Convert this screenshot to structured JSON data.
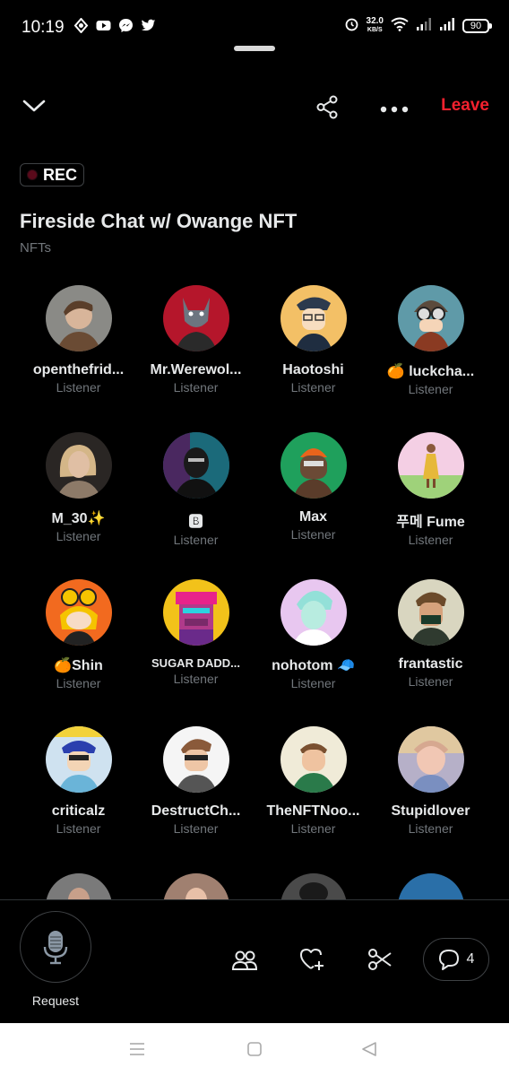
{
  "status_bar": {
    "time": "10:19",
    "net_speed": "32.0",
    "net_speed_unit": "KB/S",
    "battery": "90",
    "left_icons": [
      "sync-icon",
      "youtube-icon",
      "messenger-icon",
      "twitter-icon"
    ]
  },
  "toolbar": {
    "leave_label": "Leave",
    "collapse_icon": "chevron-down-icon",
    "share_icon": "share-icon",
    "more_icon": "more-icon"
  },
  "space": {
    "rec_label": "REC",
    "title": "Fireside Chat w/ Owange NFT",
    "topic": "NFTs"
  },
  "colors": {
    "accent_red": "#f4212e",
    "text_primary": "#e7e9ea",
    "text_secondary": "#71767b",
    "background": "#000000"
  },
  "participants": [
    {
      "name": "openthefrid...",
      "role": "Listener"
    },
    {
      "name": "Mr.Werewol...",
      "role": "Listener"
    },
    {
      "name": "Haotoshi",
      "role": "Listener"
    },
    {
      "name": "🍊 luckcha...",
      "role": "Listener"
    },
    {
      "name": "M_30✨",
      "role": "Listener"
    },
    {
      "name": "🅱",
      "role": "Listener"
    },
    {
      "name": "Max",
      "role": "Listener"
    },
    {
      "name": "푸메 Fume",
      "role": "Listener"
    },
    {
      "name": "🍊Shin",
      "role": "Listener"
    },
    {
      "name": "SUGAR DADD...",
      "role": "Listener"
    },
    {
      "name": "nohotom 🧢",
      "role": "Listener"
    },
    {
      "name": "frantastic",
      "role": "Listener"
    },
    {
      "name": "criticalz",
      "role": "Listener"
    },
    {
      "name": "DestructCh...",
      "role": "Listener"
    },
    {
      "name": "TheNFTNoo...",
      "role": "Listener"
    },
    {
      "name": "Stupidlover",
      "role": "Listener"
    }
  ],
  "bottom": {
    "request_label": "Request",
    "comments_count": "4"
  }
}
